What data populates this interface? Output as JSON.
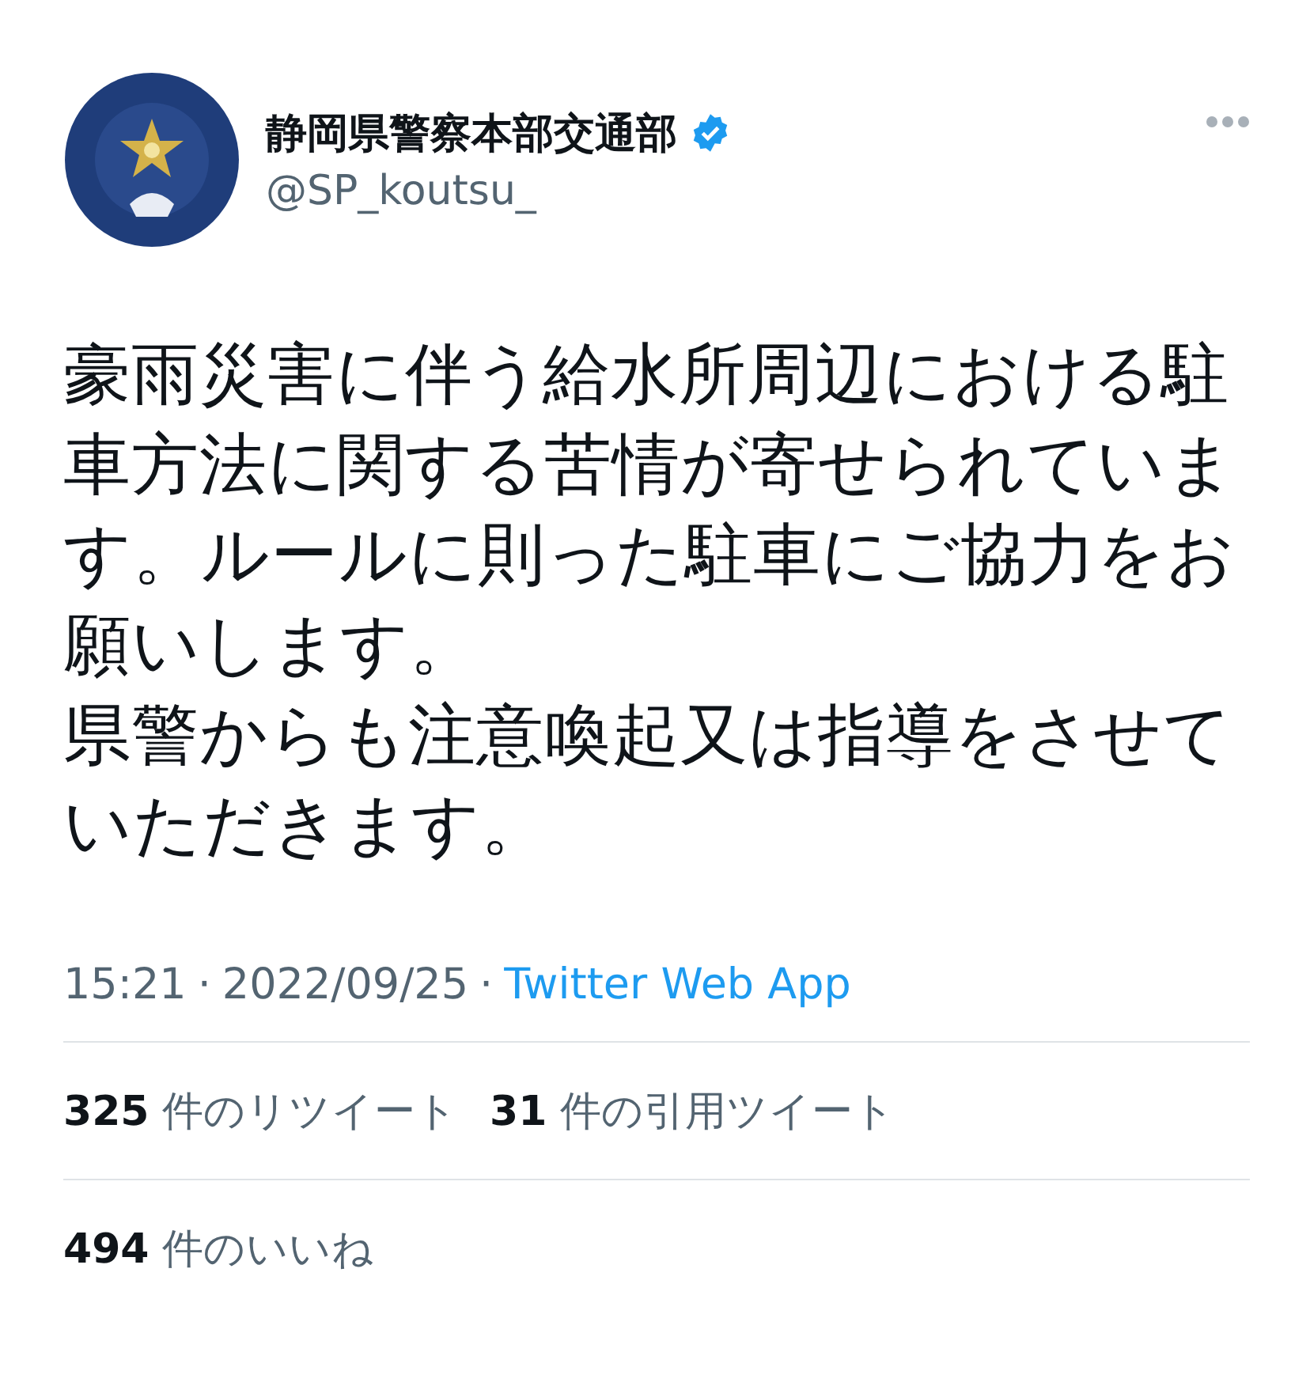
{
  "author": {
    "name": "静岡県警察本部交通部",
    "verified": true,
    "handle": "@SP_koutsu_"
  },
  "tweet": {
    "paragraphs": [
      "豪雨災害に伴う給水所周辺における駐車方法に関する苦情が寄せられています。ルールに則った駐車にご協力をお願いします。",
      "県警からも注意喚起又は指導をさせていただきます。"
    ]
  },
  "meta": {
    "time": "15:21",
    "separator_1": "·",
    "date": "2022/09/25",
    "separator_2": "·",
    "source": "Twitter Web App"
  },
  "stat_rows": [
    [
      {
        "count": "325",
        "label": "件のリツイート"
      },
      {
        "count": "31",
        "label": "件の引用ツイート"
      }
    ],
    [
      {
        "count": "494",
        "label": "件のいいね"
      }
    ]
  ]
}
